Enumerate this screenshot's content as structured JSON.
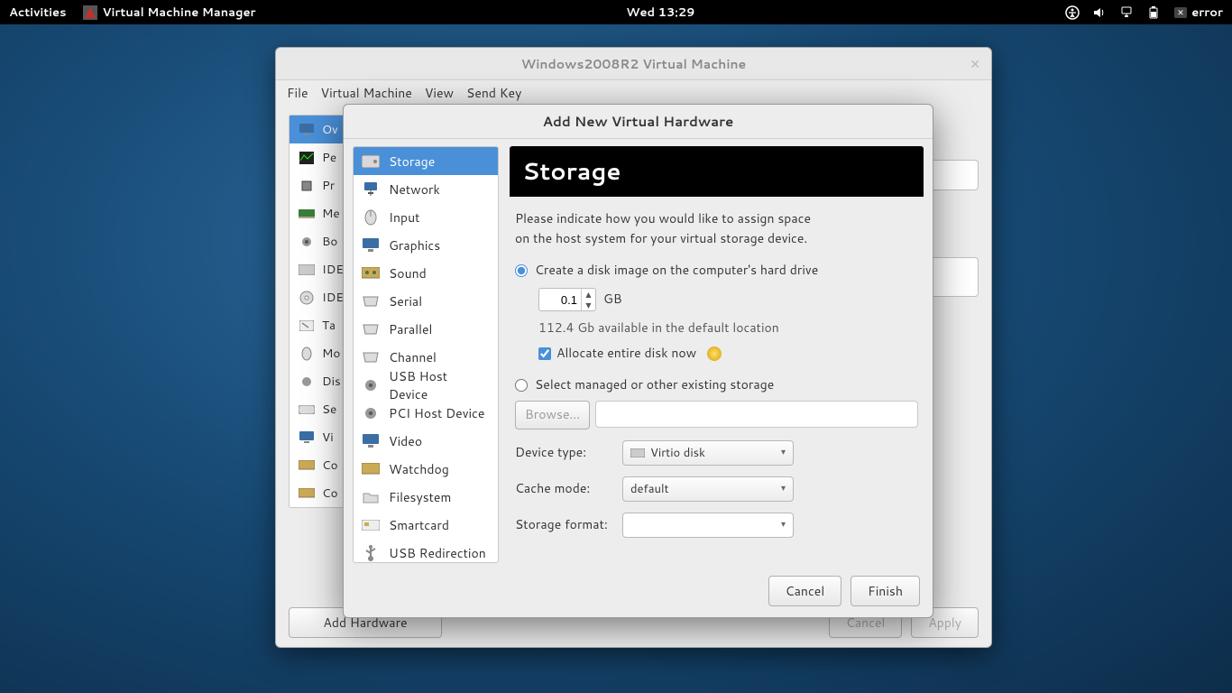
{
  "topbar": {
    "activities": "Activities",
    "app": "Virtual Machine Manager",
    "clock": "Wed 13:29",
    "error": "error"
  },
  "vmwindow": {
    "title": "Windows2008R2 Virtual Machine",
    "menu": {
      "file": "File",
      "vm": "Virtual Machine",
      "view": "View",
      "sendkey": "Send Key"
    },
    "sidebar": [
      "Ov",
      "Pe",
      "Pr",
      "Me",
      "Bo",
      "IDE",
      "IDE",
      "Ta",
      "Mo",
      "Dis",
      "Se",
      "Vi",
      "Co",
      "Co"
    ],
    "add_hw": "Add Hardware",
    "cancel": "Cancel",
    "apply": "Apply"
  },
  "dialog": {
    "title": "Add New Virtual Hardware",
    "categories": [
      "Storage",
      "Network",
      "Input",
      "Graphics",
      "Sound",
      "Serial",
      "Parallel",
      "Channel",
      "USB Host Device",
      "PCI Host Device",
      "Video",
      "Watchdog",
      "Filesystem",
      "Smartcard",
      "USB Redirection"
    ],
    "selected_index": 0,
    "panel": {
      "heading": "Storage",
      "intro1": "Please indicate how you would like to assign space",
      "intro2": "on the host system for your virtual storage device.",
      "opt_create": "Create a disk image on the computer's hard drive",
      "size_value": "0.1",
      "size_unit": "GB",
      "available": "112.4 Gb available in the default location",
      "allocate": "Allocate entire disk now",
      "opt_managed": "Select managed or other existing storage",
      "browse": "Browse...",
      "device_type_label": "Device type:",
      "device_type": "Virtio disk",
      "cache_label": "Cache mode:",
      "cache": "default",
      "format_label": "Storage format:",
      "format": ""
    },
    "cancel": "Cancel",
    "finish": "Finish"
  }
}
